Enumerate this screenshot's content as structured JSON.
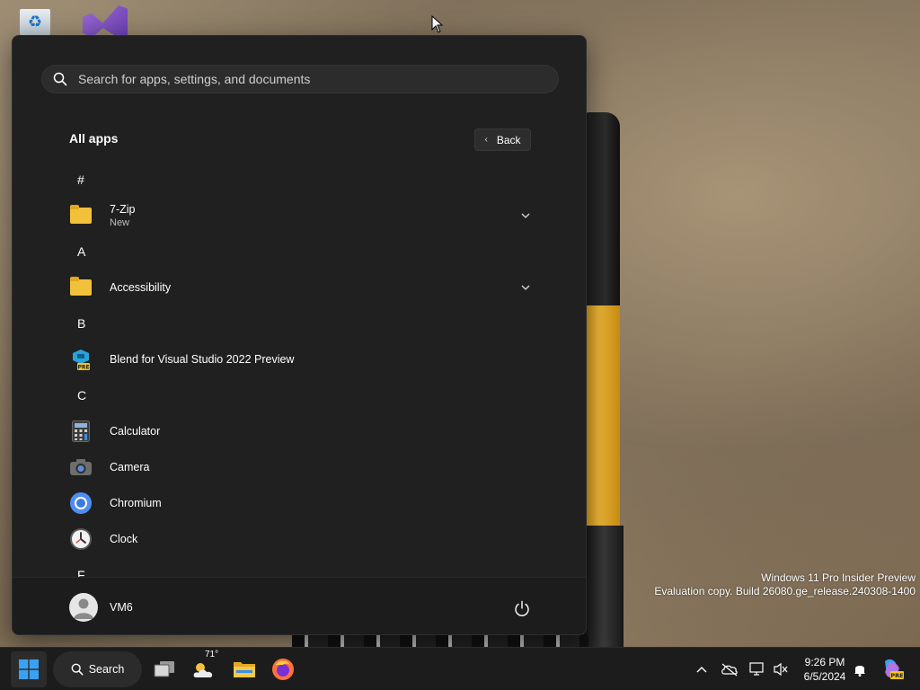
{
  "search": {
    "placeholder": "Search for apps, settings, and documents"
  },
  "header": {
    "title": "All apps",
    "back_label": "Back"
  },
  "sections": [
    {
      "letter": "#",
      "apps": [
        {
          "name": "7-Zip",
          "sub": "New",
          "icon": "folder-icon",
          "expandable": true
        }
      ]
    },
    {
      "letter": "A",
      "apps": [
        {
          "name": "Accessibility",
          "icon": "folder-icon",
          "expandable": true
        }
      ]
    },
    {
      "letter": "B",
      "apps": [
        {
          "name": "Blend for Visual Studio 2022 Preview",
          "icon": "blend-vs-icon"
        }
      ]
    },
    {
      "letter": "C",
      "apps": [
        {
          "name": "Calculator",
          "icon": "calculator-icon"
        },
        {
          "name": "Camera",
          "icon": "camera-icon"
        },
        {
          "name": "Chromium",
          "icon": "chromium-icon"
        },
        {
          "name": "Clock",
          "icon": "clock-icon"
        }
      ]
    },
    {
      "letter": "F",
      "apps": []
    }
  ],
  "footer": {
    "user_name": "VM6"
  },
  "taskbar": {
    "search_label": "Search",
    "weather_temp": "71°",
    "clock_time": "9:26 PM",
    "clock_date": "6/5/2024"
  },
  "watermark": {
    "line1": "Windows 11 Pro Insider Preview",
    "line2": "Evaluation copy. Build 26080.ge_release.240308-1400"
  },
  "colors": {
    "menu_bg": "#202020",
    "taskbar_bg": "#1c1c1c",
    "folder": "#f1c13b",
    "accent": "#3aa0f0"
  }
}
